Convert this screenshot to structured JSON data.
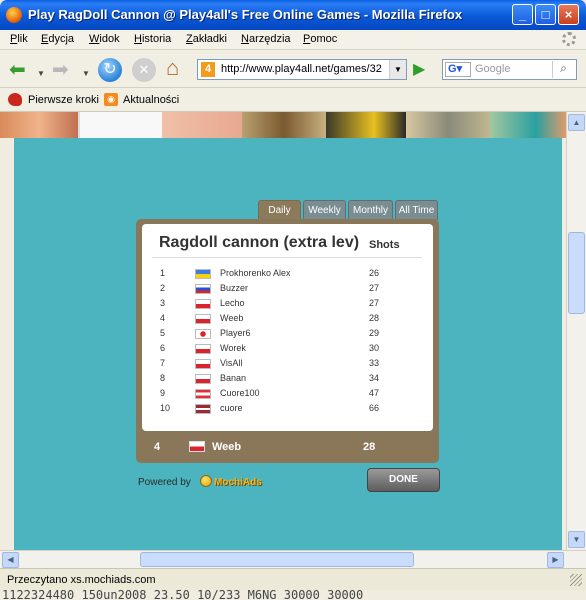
{
  "window": {
    "title": "Play RagDoll Cannon @ Play4all's Free Online Games - Mozilla Firefox"
  },
  "menu": [
    "Plik",
    "Edycja",
    "Widok",
    "Historia",
    "Zakładki",
    "Narzędzia",
    "Pomoc"
  ],
  "nav": {
    "url": "http://www.play4all.net/games/32",
    "search_engine_letter": "G",
    "search_placeholder": "Google"
  },
  "bookmarks": [
    "Pierwsze kroki",
    "Aktualności"
  ],
  "leaderboard": {
    "tabs": [
      "Daily",
      "Weekly",
      "Monthly",
      "All Time"
    ],
    "active_tab": "Daily",
    "title": "Ragdoll cannon (extra lev)",
    "shots_header": "Shots",
    "rows": [
      {
        "rank": "1",
        "flag": "ua",
        "name": "Prokhorenko Alex",
        "shots": "26"
      },
      {
        "rank": "2",
        "flag": "ru",
        "name": "Buzzer",
        "shots": "27"
      },
      {
        "rank": "3",
        "flag": "pl",
        "name": "Lecho",
        "shots": "27"
      },
      {
        "rank": "4",
        "flag": "pl",
        "name": "Weeb",
        "shots": "28"
      },
      {
        "rank": "5",
        "flag": "jp",
        "name": "Player6",
        "shots": "29"
      },
      {
        "rank": "6",
        "flag": "pl",
        "name": "Worek",
        "shots": "30"
      },
      {
        "rank": "7",
        "flag": "pl",
        "name": "VisAll",
        "shots": "33"
      },
      {
        "rank": "8",
        "flag": "pl",
        "name": "Banan",
        "shots": "34"
      },
      {
        "rank": "9",
        "flag": "at",
        "name": "Cuore100",
        "shots": "47"
      },
      {
        "rank": "10",
        "flag": "lv",
        "name": "cuore",
        "shots": "66"
      }
    ],
    "you": {
      "rank": "4",
      "flag": "pl",
      "name": "Weeb",
      "shots": "28"
    },
    "powered_by": "Powered by",
    "mochi": "MochiAds",
    "done": "DONE"
  },
  "status": {
    "text": "Przeczytano xs.mochiads.com",
    "ticker": "1122324480 150un2008 23.50   10/233 M6NG  30000  30000"
  },
  "colors": {
    "game_bg": "#4bb4be",
    "board_frame": "#8a775a",
    "tab_active": "#8c7a5c",
    "tab_inactive": "#7a8d93"
  }
}
